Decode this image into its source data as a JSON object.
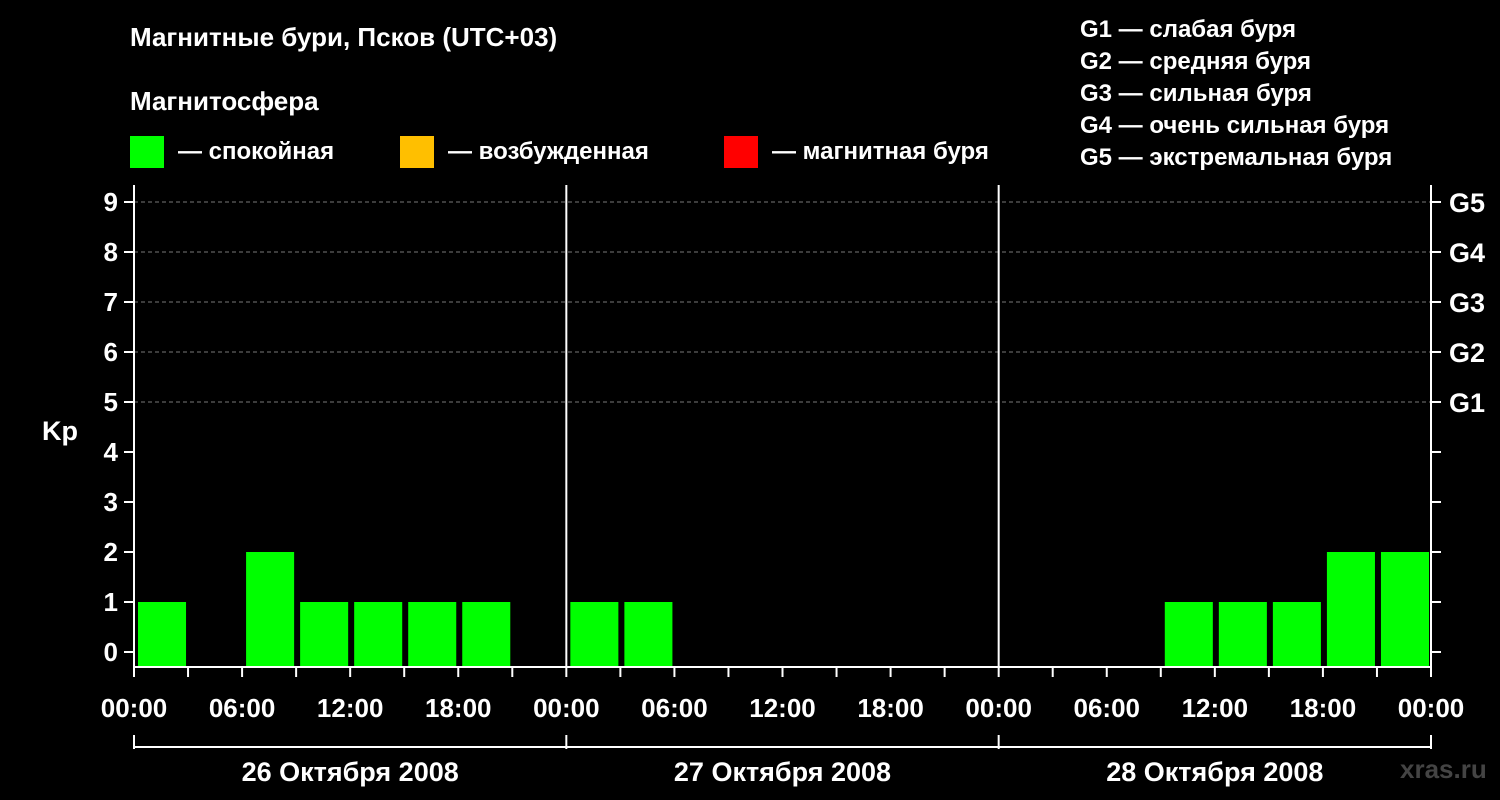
{
  "title": "Магнитные бури, Псков (UTC+03)",
  "subtitle": "Магнитосфера",
  "legend": [
    {
      "label": "— спокойная",
      "color": "#00ff00"
    },
    {
      "label": "— возбужденная",
      "color": "#ffbf00"
    },
    {
      "label": "— магнитная буря",
      "color": "#ff0000"
    }
  ],
  "g_legend": [
    "G1 — слабая буря",
    "G2 — средняя буря",
    "G3 — сильная буря",
    "G4 — очень сильная буря",
    "G5 — экстремальная буря"
  ],
  "watermark": "xras.ru",
  "chart_data": {
    "type": "bar",
    "title": "Магнитные бури, Псков (UTC+03)",
    "ylabel": "Kp",
    "ylim": [
      0,
      9
    ],
    "y_ticks": [
      "0",
      "1",
      "2",
      "3",
      "4",
      "5",
      "6",
      "7",
      "8",
      "9"
    ],
    "right_labels": [
      {
        "kp": 5,
        "label": "G1"
      },
      {
        "kp": 6,
        "label": "G2"
      },
      {
        "kp": 7,
        "label": "G3"
      },
      {
        "kp": 8,
        "label": "G4"
      },
      {
        "kp": 9,
        "label": "G5"
      }
    ],
    "x_tick_labels": [
      "00:00",
      "06:00",
      "12:00",
      "18:00",
      "00:00",
      "06:00",
      "12:00",
      "18:00",
      "00:00",
      "06:00",
      "12:00",
      "18:00",
      "00:00"
    ],
    "days": [
      "26 Октября 2008",
      "27 Октября 2008",
      "28 Октября 2008"
    ],
    "interval_hours": 3,
    "values": [
      1,
      0,
      2,
      1,
      1,
      1,
      1,
      0,
      1,
      1,
      0,
      0,
      0,
      0,
      0,
      0,
      0,
      0,
      0,
      1,
      1,
      1,
      2,
      2
    ],
    "grid": "dashed at Kp 5-9",
    "colors": {
      "quiet": "#00ff00",
      "active": "#ffbf00",
      "storm": "#ff0000"
    }
  }
}
